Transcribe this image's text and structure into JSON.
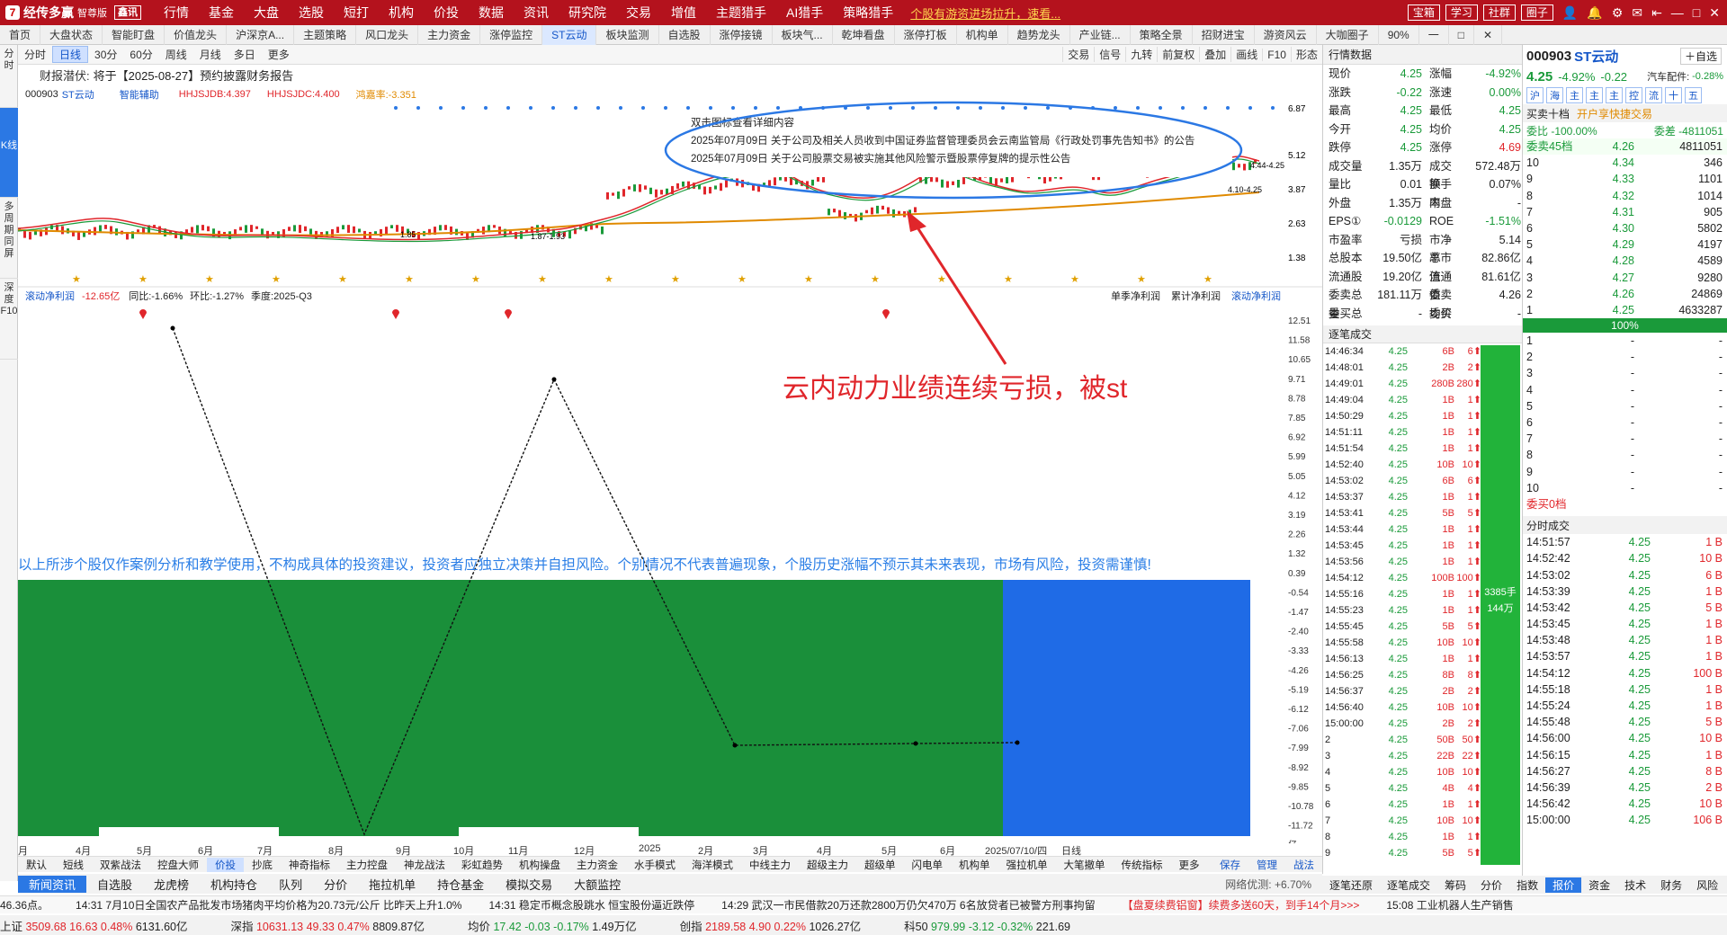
{
  "topbar": {
    "app_name": "经传多赢",
    "edition": "智尊版",
    "edition_tag": "鑫讯",
    "menu": [
      "行情",
      "基金",
      "大盘",
      "选股",
      "短打",
      "机构",
      "价投",
      "数据",
      "资讯",
      "研究院",
      "交易",
      "增值",
      "主题猎手",
      "AI猎手",
      "策略猎手"
    ],
    "marquee": "个股有游资进场拉升，速看...",
    "right_buttons": [
      "宝箱",
      "学习",
      "社群",
      "圈子"
    ]
  },
  "navtabs": [
    "首页",
    "大盘状态",
    "智能盯盘",
    "价值龙头",
    "沪深京A...",
    "主题策略",
    "风口龙头",
    "主力资金",
    "涨停监控",
    "ST云动",
    "板块监测",
    "自选股",
    "涨停接镜",
    "板块气...",
    "乾坤看盘",
    "涨停打板",
    "机构单",
    "趋势龙头",
    "产业链...",
    "策略全景",
    "招财进宝",
    "游资风云",
    "大咖圈子",
    "90%",
    "一",
    "□",
    "✕"
  ],
  "active_tab": "ST云动",
  "sidebar": [
    {
      "label": "分时"
    },
    {
      "label": "K线"
    },
    {
      "label": "多周期同屏"
    },
    {
      "label": "深度F10"
    }
  ],
  "chartbar": {
    "left": [
      "分时",
      "日线",
      "30分",
      "60分",
      "周线",
      "月线",
      "多日",
      "更多"
    ],
    "active": "日线",
    "right": [
      "交易",
      "信号",
      "九转",
      "前复权",
      "叠加",
      "画线",
      "F10",
      "形态"
    ]
  },
  "info": {
    "label": "财报潜伏:",
    "announcement": "将于【2025-08-27】预约披露财务报告"
  },
  "legend": {
    "code": "000903",
    "name": "ST云动",
    "assist": "智能辅助",
    "hhjsjdb": "HHJSJDB:4.397",
    "hhjsjdc": "HHJSJDC:4.400",
    "rate": "鸿嘉率:-3.351"
  },
  "kchart": {
    "price_axis": [
      "6.87",
      "5.12",
      "3.87",
      "2.63",
      "1.38"
    ],
    "annotations": [
      "1.85",
      "1.87-1.93",
      "4.44-4.25",
      "4.10-4.25"
    ]
  },
  "tooltip": {
    "title": "双击图标查看详细内容",
    "line1": "2025年07月09日 关于公司及相关人员收到中国证券监督管理委员会云南监管局《行政处罚事先告知书》的公告",
    "line2": "2025年07月09日 关于公司股票交易被实施其他风险警示暨股票停复牌的提示性公告"
  },
  "big_annotation": "云内动力业绩连续亏损，被st",
  "subchart": {
    "title": "滚动净利润",
    "value": "-12.65亿",
    "yoy": "同比:-1.66%",
    "qoq": "环比:-1.27%",
    "season": "季度:2025-Q3",
    "tabs": [
      "单季净利润",
      "累计净利润",
      "滚动净利润"
    ],
    "yaxis": [
      "12.51",
      "11.58",
      "10.65",
      "9.71",
      "8.78",
      "7.85",
      "6.92",
      "5.99",
      "5.05",
      "4.12",
      "3.19",
      "2.26",
      "1.32",
      "0.39",
      "-0.54",
      "-1.47",
      "-2.40",
      "-3.33",
      "-4.26",
      "-5.19",
      "-6.12",
      "-7.06",
      "-7.99",
      "-8.92",
      "-9.85",
      "-10.78",
      "-11.72",
      "亿"
    ]
  },
  "disclaimer": "以上所涉个股仅作案例分析和教学使用，不构成具体的投资建议，投资者应独立决策并自担风险。个别情况不代表普遍现象，个股历史涨幅不预示其未来表现，市场有风险，投资需谨慎!",
  "xaxis": [
    "月",
    "4月",
    "5月",
    "6月",
    "7月",
    "8月",
    "9月",
    "10月",
    "11月",
    "12月",
    "2025",
    "2月",
    "3月",
    "4月",
    "5月",
    "6月",
    "2025/07/10/四",
    "日线"
  ],
  "indicator_tabs": [
    "默认",
    "短线",
    "双紫战法",
    "控盘大师",
    "价投",
    "抄底",
    "神奇指标",
    "主力控盘",
    "神龙战法",
    "彩虹趋势",
    "机构操盘",
    "主力资金",
    "水手模式",
    "海洋模式",
    "中线主力",
    "超级主力",
    "超级单",
    "闪电单",
    "机构单",
    "强拉机单",
    "大笔撤单",
    "传统指标",
    "更多"
  ],
  "indicator_active": "价投",
  "indicator_right": [
    "保存",
    "管理",
    "战法"
  ],
  "newsbar": [
    "新闻资讯",
    "自选股",
    "龙虎榜",
    "机构持仓",
    "队列",
    "分价",
    "拖拉机单",
    "持仓基金",
    "模拟交易",
    "大额监控"
  ],
  "net_latency": "网络优测: +6.70%",
  "bottomscroll": [
    "46.36点。",
    "14:31 7月10日全国农产品批发市场猪肉平均价格为20.73元/公斤 比昨天上升1.0%",
    "14:31 稳定币概念股跳水 恒宝股份逼近跌停",
    "14:29 武汉一市民借款20万还款2800万仍欠470万 6名放贷者已被警方刑事拘留",
    "【盘夏续费铝窗】续费多送60天，到手14个月>>>",
    "15:08 工业机器人生产销售"
  ],
  "indexbar": [
    {
      "name": "上证",
      "val": "3509.68",
      "chg": "16.63",
      "pct": "0.48%",
      "amt": "6131.60亿"
    },
    {
      "name": "深指",
      "val": "10631.13",
      "chg": "49.33",
      "pct": "0.47%",
      "amt": "8809.87亿"
    },
    {
      "name": "均价",
      "val": "17.42",
      "chg": "-0.03",
      "pct": "-0.17%",
      "amt": "1.49万亿"
    },
    {
      "name": "创指",
      "val": "2189.58",
      "chg": "4.90",
      "pct": "0.22%",
      "amt": "1026.27亿"
    },
    {
      "name": "科50",
      "val": "979.99",
      "chg": "-3.12",
      "pct": "-0.32%",
      "amt": "221.69"
    }
  ],
  "quote": {
    "header": "行情数据",
    "rows": [
      [
        "现价",
        "4.25",
        "涨幅",
        "-4.92%"
      ],
      [
        "涨跌",
        "-0.22",
        "涨速",
        "0.00%"
      ],
      [
        "最高",
        "4.25",
        "最低",
        "4.25"
      ],
      [
        "今开",
        "4.25",
        "均价",
        "4.25"
      ],
      [
        "跌停",
        "4.25",
        "涨停",
        "4.69"
      ],
      [
        "成交量",
        "1.35万",
        "成交额",
        "572.48万"
      ],
      [
        "量比",
        "0.01",
        "换手率",
        "0.07%"
      ],
      [
        "外盘",
        "1.35万",
        "内盘",
        "-"
      ],
      [
        "EPS①",
        "-0.0129",
        "ROE",
        "-1.51%"
      ],
      [
        "市盈率",
        "亏损",
        "市净率",
        "5.14"
      ],
      [
        "总股本",
        "19.50亿",
        "总市值",
        "82.86亿"
      ],
      [
        "流通股",
        "19.20亿",
        "流通值",
        "81.61亿"
      ],
      [
        "委卖总量",
        "181.11万",
        "委卖均价",
        "4.26"
      ],
      [
        "委买总量",
        "-",
        "委买均价",
        "-"
      ]
    ]
  },
  "ticks": {
    "header": "逐笔成交",
    "rows": [
      [
        "14:46:34",
        "4.25",
        "6B",
        "6"
      ],
      [
        "14:48:01",
        "4.25",
        "2B",
        "2"
      ],
      [
        "14:49:01",
        "4.25",
        "280B",
        "280"
      ],
      [
        "14:49:04",
        "4.25",
        "1B",
        "1"
      ],
      [
        "14:50:29",
        "4.25",
        "1B",
        "1"
      ],
      [
        "14:51:11",
        "4.25",
        "1B",
        "1"
      ],
      [
        "14:51:54",
        "4.25",
        "1B",
        "1"
      ],
      [
        "14:52:40",
        "4.25",
        "10B",
        "10"
      ],
      [
        "14:53:02",
        "4.25",
        "6B",
        "6"
      ],
      [
        "14:53:37",
        "4.25",
        "1B",
        "1"
      ],
      [
        "14:53:41",
        "4.25",
        "5B",
        "5"
      ],
      [
        "14:53:44",
        "4.25",
        "1B",
        "1"
      ],
      [
        "14:53:45",
        "4.25",
        "1B",
        "1"
      ],
      [
        "14:53:56",
        "4.25",
        "1B",
        "1"
      ],
      [
        "14:54:12",
        "4.25",
        "100B",
        "100"
      ],
      [
        "14:55:16",
        "4.25",
        "1B",
        "1"
      ],
      [
        "14:55:23",
        "4.25",
        "1B",
        "1"
      ],
      [
        "14:55:45",
        "4.25",
        "5B",
        "5"
      ],
      [
        "14:55:58",
        "4.25",
        "10B",
        "10"
      ],
      [
        "14:56:13",
        "4.25",
        "1B",
        "1"
      ],
      [
        "14:56:25",
        "4.25",
        "8B",
        "8"
      ],
      [
        "14:56:37",
        "4.25",
        "2B",
        "2"
      ],
      [
        "14:56:40",
        "4.25",
        "10B",
        "10"
      ],
      [
        "15:00:00",
        "4.25",
        "2B",
        "2"
      ],
      [
        "2",
        "4.25",
        "50B",
        "50"
      ],
      [
        "3",
        "4.25",
        "22B",
        "22"
      ],
      [
        "4",
        "4.25",
        "10B",
        "10"
      ],
      [
        "5",
        "4.25",
        "4B",
        "4"
      ],
      [
        "6",
        "4.25",
        "1B",
        "1"
      ],
      [
        "7",
        "4.25",
        "10B",
        "10"
      ],
      [
        "8",
        "4.25",
        "1B",
        "1"
      ],
      [
        "9",
        "4.25",
        "5B",
        "5"
      ]
    ],
    "green_bar_text": "3385手 144万"
  },
  "right": {
    "code": "000903",
    "name": "ST云动",
    "self_select": "自选",
    "price": "4.25",
    "pct": "-4.92%",
    "chg": "-0.22",
    "sector": "汽车配件:",
    "sector_pct": "-0.28%",
    "quick_tabs": [
      "沪",
      "海",
      "主",
      "主",
      "主",
      "控",
      "流",
      "十",
      "五"
    ],
    "depth_title": "买卖十档",
    "depth_promo": "开户享快捷交易",
    "weibi": "委比 -100.00%",
    "weicha": "委差 -4811051",
    "sell45": "委卖45档",
    "sell45_price": "4.26",
    "sell45_vol": "4811051",
    "sells": [
      [
        "10",
        "4.34",
        "346"
      ],
      [
        "9",
        "4.33",
        "1101"
      ],
      [
        "8",
        "4.32",
        "1014"
      ],
      [
        "7",
        "4.31",
        "905"
      ],
      [
        "6",
        "4.30",
        "5802"
      ],
      [
        "5",
        "4.29",
        "4197"
      ],
      [
        "4",
        "4.28",
        "4589"
      ],
      [
        "3",
        "4.27",
        "9280"
      ],
      [
        "2",
        "4.26",
        "24869"
      ],
      [
        "1",
        "4.25",
        "4633287"
      ]
    ],
    "bar_pct": "100%",
    "buys": [
      [
        "1",
        "-",
        "-"
      ],
      [
        "2",
        "-",
        "-"
      ],
      [
        "3",
        "-",
        "-"
      ],
      [
        "4",
        "-",
        "-"
      ],
      [
        "5",
        "-",
        "-"
      ],
      [
        "6",
        "-",
        "-"
      ],
      [
        "7",
        "-",
        "-"
      ],
      [
        "8",
        "-",
        "-"
      ],
      [
        "9",
        "-",
        "-"
      ],
      [
        "10",
        "-",
        "-"
      ]
    ],
    "buy_title": "委买0档",
    "fs_title": "分时成交",
    "fs": [
      [
        "14:51:57",
        "4.25",
        "1 B"
      ],
      [
        "14:52:42",
        "4.25",
        "10 B"
      ],
      [
        "14:53:02",
        "4.25",
        "6 B"
      ],
      [
        "14:53:39",
        "4.25",
        "1 B"
      ],
      [
        "14:53:42",
        "4.25",
        "5 B"
      ],
      [
        "14:53:45",
        "4.25",
        "1 B"
      ],
      [
        "14:53:48",
        "4.25",
        "1 B"
      ],
      [
        "14:53:57",
        "4.25",
        "1 B"
      ],
      [
        "14:54:12",
        "4.25",
        "100 B"
      ],
      [
        "14:55:18",
        "4.25",
        "1 B"
      ],
      [
        "14:55:24",
        "4.25",
        "1 B"
      ],
      [
        "14:55:48",
        "4.25",
        "5 B"
      ],
      [
        "14:56:00",
        "4.25",
        "10 B"
      ],
      [
        "14:56:15",
        "4.25",
        "1 B"
      ],
      [
        "14:56:27",
        "4.25",
        "8 B"
      ],
      [
        "14:56:39",
        "4.25",
        "2 B"
      ],
      [
        "14:56:42",
        "4.25",
        "10 B"
      ],
      [
        "15:00:00",
        "4.25",
        "106 B"
      ]
    ]
  },
  "rtabs": [
    "逐笔还原",
    "逐笔成交",
    "筹码",
    "分价",
    "指数",
    "报价",
    "资金",
    "技术",
    "财务",
    "风险",
    "股本",
    "异动",
    "情报"
  ],
  "rtabs_active": "报价",
  "colors": {
    "red": "#e0262b",
    "green": "#1a9a3a",
    "blue": "#2b78e4",
    "brand": "#b4121d"
  }
}
